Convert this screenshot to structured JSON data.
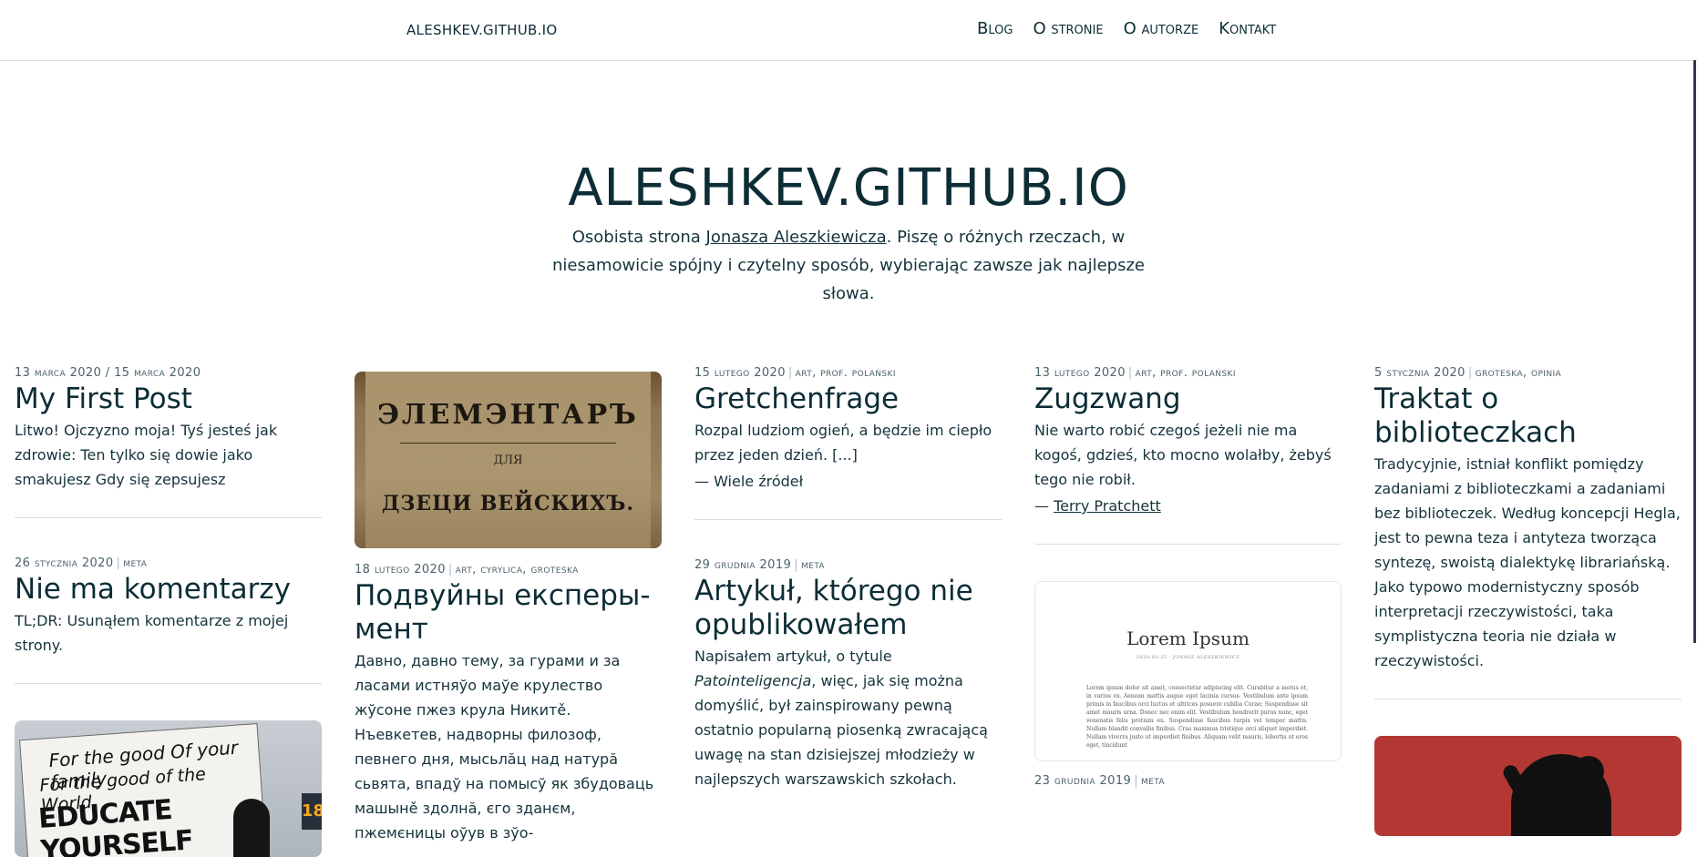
{
  "header": {
    "site_name": "ALESHKEV.GITHUB.IO",
    "nav": [
      "Blog",
      "O stronie",
      "O autorze",
      "Kontakt"
    ]
  },
  "hero": {
    "title": "ALESHKEV.GITHUB.IO",
    "sub_before": "Osobista strona ",
    "sub_link": "Jonasza Aleszkiewicza",
    "sub_after": ". Piszę o różnych rzeczach, w niesamowicie spójny i czytelny sposób, wybierając zawsze jak najlepsze słowa."
  },
  "posts": {
    "p1": {
      "date": "13 marca 2020 / 15 marca 2020",
      "title": "My First Post",
      "excerpt": "Litwo! Ojczyzno moja! Tyś jesteś jak zdrowie: Ten tylko się dowie jako smakujesz Gdy się zepsujesz"
    },
    "p2": {
      "date": "26 stycznia 2020",
      "tags": "meta",
      "title": "Nie ma komentarzy",
      "excerpt": "TL;DR: Usunąłem komentarze z mojej strony."
    },
    "p3": {
      "date": "18 lutego 2020",
      "tags": "art, cyrylica, groteska",
      "title": "Подвуйны експеры­мент",
      "excerpt": "Давно, давно тему, за гурами и за ласами истняўо маўе крулество жўсоне пжез крула Никитě. Нъевкетев, надворны филозоф, певнего дня, мысьлăц над натурă сьвята, впадў на помысў як збудоваць машынě здолнă, єго зданєм, пжемєницы оўув в зўо-"
    },
    "p4": {
      "date": "15 lutego 2020",
      "tags": "art, prof. polański",
      "title": "Gretchenfrage",
      "excerpt": "Rozpal ludziom ogień, a będzie im ciepło przez jeden dzień. [...]",
      "attribution": "— Wiele źródeł"
    },
    "p5": {
      "date": "29 grudnia 2019",
      "tags": "meta",
      "title": "Artykuł, którego nie opublikowałem",
      "excerpt_before": "Napisałem artykuł, o tytule ",
      "excerpt_em": "Patointeligencja",
      "excerpt_after": ", więc, jak się można domyślić, był zainspirowany pewną ostatnio popularną piosenką zwracającą uwagę na stan dzisiejszej młodzieży w najlepszych warszawskich szkołach."
    },
    "p6": {
      "date": "13 lutego 2020",
      "tags": "art, prof. polański",
      "title": "Zugzwang",
      "excerpt": "Nie warto robić czegoś jeżeli nie ma kogoś, gdzieś, kto mocno wolałby, żebyś tego nie robił.",
      "attribution_dash": "— ",
      "attribution_link": "Terry Pratchett"
    },
    "p7": {
      "date": "23 grudnia 2019",
      "tags": "meta"
    },
    "p8": {
      "date": "5 stycznia 2020",
      "tags": "groteska, opinia",
      "title": "Traktat o biblioteczkach",
      "excerpt": "Tradycyjnie, istniał konflikt pomiędzy zadaniami z biblioteczkami a zadaniami bez biblioteczek. Według koncepcji Hegla, jest to pewna teza i antyteza tworząca syntezę, swoistą dialektykę librariańską. Jako typowo modernistyczny sposób interpretacji rzeczywistości, taka symplistyczna teoria nie działa w rzeczywistości."
    }
  },
  "images": {
    "book": {
      "line1": "ЭЛЕМЭНТАРЪ",
      "line2": "ДЛЯ",
      "line3": "ДЗЕЦИ ВЕЙСКИХЪ."
    },
    "sign": {
      "line1": "For the good Of your family",
      "line2": "For the good of the World",
      "line3": "EDUCATE YOURSELF",
      "bus": "18"
    },
    "lorem": {
      "title": "Lorem Ipsum",
      "subtitle": "2020-03-25 · JONASZ ALESZKIEWICZ",
      "body": "Lorem ipsum dolor sit amet, consectetur adipiscing elit. Curabitur a metus et, in varius ex. Aenean mattis augue eget lacinia cursus. Vestibulum ante ipsum primis in faucibus orci luctus et ultrices posuere cubilia Curae; Suspendisse sit amet mauris urna. Donec nec enim elit. Vestibulum hendrerit purus nunc, eget venenatis felis pretium eu. Suspendisse faucibus turpis vel tempor mattis. Nullam blandit convallis finibus. Cras maximus tristique orci aliquet imperdiet. Nullam viverra justo ut imperdiet finibus. Aliquam velit mauris, lobortis ut eros eget, tincidunt"
    }
  },
  "colors": {
    "text": "#0c2d36",
    "muted": "#4c626a",
    "divider": "#d9dee0",
    "red": "#b33834"
  }
}
